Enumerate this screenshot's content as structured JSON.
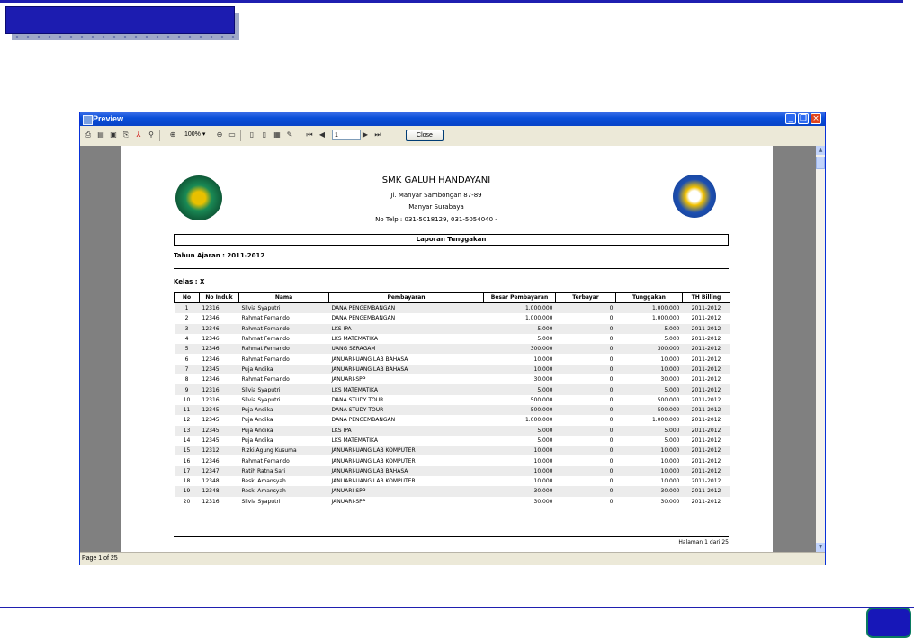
{
  "window": {
    "title": "Preview"
  },
  "toolbar": {
    "zoom": "100%",
    "page_number": "1",
    "close_label": "Close"
  },
  "statusbar": {
    "text": "Page 1 of 25"
  },
  "report": {
    "school_name": "SMK GALUH HANDAYANI",
    "address_1": "Jl. Manyar Sambongan 87-89",
    "address_2": "Manyar Surabaya",
    "phone": "No Telp : 031-5018129, 031-5054040  -",
    "title": "Laporan Tunggakan",
    "school_year": "Tahun Ajaran : 2011-2012",
    "class": "Kelas :  X",
    "columns": [
      "No",
      "No Induk",
      "Nama",
      "Pembayaran",
      "Besar Pembayaran",
      "Terbayar",
      "Tunggakan",
      "TH Billing"
    ],
    "rows": [
      [
        "1",
        "12316",
        "Silvia Syaputri",
        "DANA PENGEMBANGAN",
        "1.000.000",
        "0",
        "1.000.000",
        "2011-2012"
      ],
      [
        "2",
        "12346",
        "Rahmat Fernando",
        "DANA PENGEMBANGAN",
        "1.000.000",
        "0",
        "1.000.000",
        "2011-2012"
      ],
      [
        "3",
        "12346",
        "Rahmat Fernando",
        "LKS IPA",
        "5.000",
        "0",
        "5.000",
        "2011-2012"
      ],
      [
        "4",
        "12346",
        "Rahmat Fernando",
        "LKS MATEMATIKA",
        "5.000",
        "0",
        "5.000",
        "2011-2012"
      ],
      [
        "5",
        "12346",
        "Rahmat Fernando",
        "UANG SERAGAM",
        "300.000",
        "0",
        "300.000",
        "2011-2012"
      ],
      [
        "6",
        "12346",
        "Rahmat Fernando",
        "JANUARI-UANG LAB BAHASA",
        "10.000",
        "0",
        "10.000",
        "2011-2012"
      ],
      [
        "7",
        "12345",
        "Puja Andika",
        "JANUARI-UANG LAB BAHASA",
        "10.000",
        "0",
        "10.000",
        "2011-2012"
      ],
      [
        "8",
        "12346",
        "Rahmat Fernando",
        "JANUARI-SPP",
        "30.000",
        "0",
        "30.000",
        "2011-2012"
      ],
      [
        "9",
        "12316",
        "Silvia Syaputri",
        "LKS MATEMATIKA",
        "5.000",
        "0",
        "5.000",
        "2011-2012"
      ],
      [
        "10",
        "12316",
        "Silvia Syaputri",
        "DANA STUDY TOUR",
        "500.000",
        "0",
        "500.000",
        "2011-2012"
      ],
      [
        "11",
        "12345",
        "Puja Andika",
        "DANA STUDY TOUR",
        "500.000",
        "0",
        "500.000",
        "2011-2012"
      ],
      [
        "12",
        "12345",
        "Puja Andika",
        "DANA PENGEMBANGAN",
        "1.000.000",
        "0",
        "1.000.000",
        "2011-2012"
      ],
      [
        "13",
        "12345",
        "Puja Andika",
        "LKS IPA",
        "5.000",
        "0",
        "5.000",
        "2011-2012"
      ],
      [
        "14",
        "12345",
        "Puja Andika",
        "LKS MATEMATIKA",
        "5.000",
        "0",
        "5.000",
        "2011-2012"
      ],
      [
        "15",
        "12312",
        "Rizki Agung Kusuma",
        "JANUARI-UANG LAB KOMPUTER",
        "10.000",
        "0",
        "10.000",
        "2011-2012"
      ],
      [
        "16",
        "12346",
        "Rahmat Fernando",
        "JANUARI-UANG LAB KOMPUTER",
        "10.000",
        "0",
        "10.000",
        "2011-2012"
      ],
      [
        "17",
        "12347",
        "Ratih Ratna Sari",
        "JANUARI-UANG LAB BAHASA",
        "10.000",
        "0",
        "10.000",
        "2011-2012"
      ],
      [
        "18",
        "12348",
        "Reski Amansyah",
        "JANUARI-UANG LAB KOMPUTER",
        "10.000",
        "0",
        "10.000",
        "2011-2012"
      ],
      [
        "19",
        "12348",
        "Reski Amansyah",
        "JANUARI-SPP",
        "30.000",
        "0",
        "30.000",
        "2011-2012"
      ],
      [
        "20",
        "12316",
        "Silvia Syaputri",
        "JANUARI-SPP",
        "30.000",
        "0",
        "30.000",
        "2011-2012"
      ]
    ],
    "footer": "Halaman  1 dari 25"
  },
  "icons": [
    "print-icon",
    "open-icon",
    "save-icon",
    "export-icon",
    "pdf-icon",
    "find-icon",
    "zoom-icon",
    "zoom-out-icon",
    "page-width-icon",
    "single-page-icon",
    "two-pages-icon",
    "multi-page-icon",
    "edit-icon",
    "first-page-icon",
    "prev-page-icon",
    "next-page-icon",
    "last-page-icon"
  ]
}
